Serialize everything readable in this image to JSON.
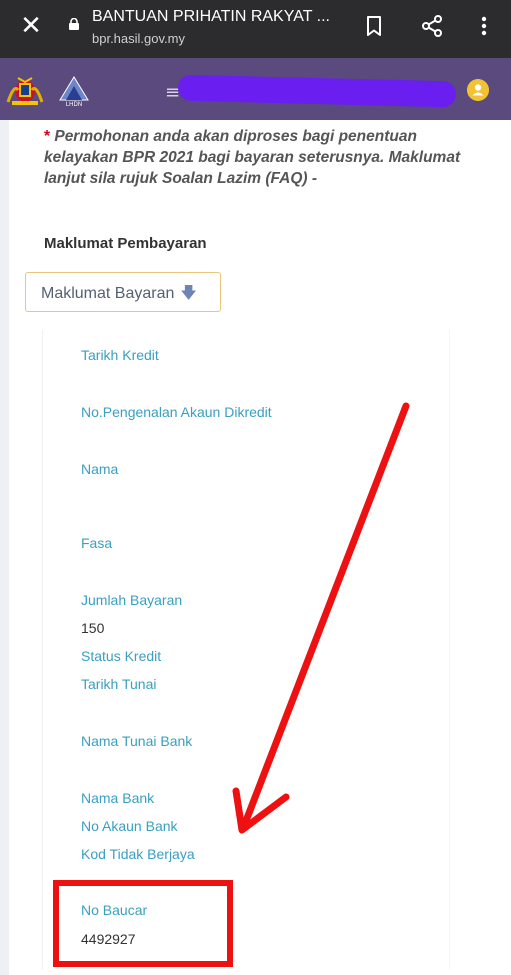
{
  "browser": {
    "title": "BANTUAN PRIHATIN RAKYAT ...",
    "url": "bpr.hasil.gov.my",
    "icons": [
      "close-icon",
      "lock-icon",
      "bookmark-icon",
      "share-icon",
      "more-vert-icon"
    ]
  },
  "header": {
    "menu_glyph": "≡",
    "logo_lhdn_text": "LHDN",
    "icons": [
      "menu-icon",
      "user-avatar-icon"
    ]
  },
  "notice": {
    "star": "*",
    "text": " Permohonan anda akan diproses bagi penentuan kelayakan BPR 2021 bagi bayaran seterusnya. Maklumat lanjut sila rujuk Soalan Lazim (FAQ) -"
  },
  "section": {
    "title": "Maklumat Pembayaran",
    "button_label": "Maklumat Bayaran",
    "button_arrow": "🡇"
  },
  "fields": {
    "tarikh_kredit": "Tarikh Kredit",
    "no_pengenalan": "No.Pengenalan Akaun Dikredit",
    "nama": "Nama",
    "fasa": "Fasa",
    "jumlah_bayaran": "Jumlah Bayaran",
    "jumlah_bayaran_value": "150",
    "status_kredit": "Status Kredit",
    "tarikh_tunai": "Tarikh Tunai",
    "nama_tunai_bank": "Nama Tunai Bank",
    "nama_bank": "Nama Bank",
    "no_akaun_bank": "No Akaun Bank",
    "kod_tidak_berjaya": "Kod Tidak Berjaya",
    "no_baucar": "No Baucar",
    "no_baucar_value": "4492927"
  },
  "colors": {
    "browser_bar": "#2c2c2e",
    "site_header": "#5a4a7e",
    "label": "#3a9fc0",
    "annotation_red": "#ee1111",
    "redaction": "#6a1ef0"
  }
}
